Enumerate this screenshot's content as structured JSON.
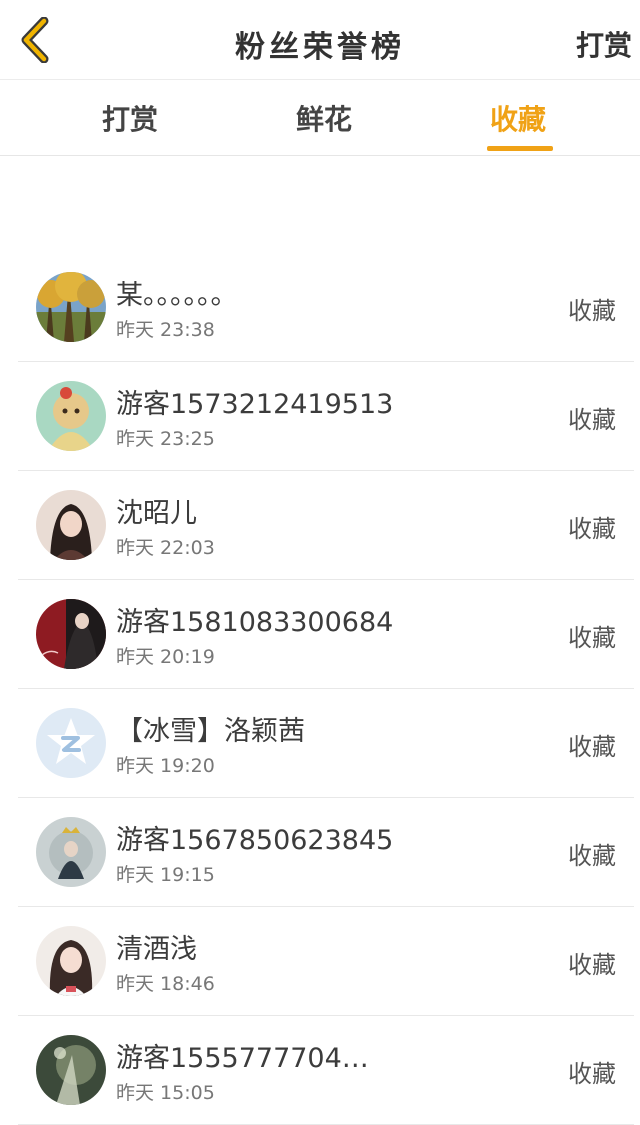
{
  "header": {
    "title": "粉丝荣誉榜",
    "action": "打赏",
    "back_icon": "chevron-left-icon",
    "back_color": "#f0b400"
  },
  "tabs": [
    {
      "label": "打赏",
      "active": false
    },
    {
      "label": "鲜花",
      "active": false
    },
    {
      "label": "收藏",
      "active": true
    }
  ],
  "accent_color": "#f0a216",
  "fans": [
    {
      "name": "某。。。。。。",
      "time": "昨天 23:38",
      "action": "收藏"
    },
    {
      "name": "游客1573212419513",
      "time": "昨天 23:25",
      "action": "收藏"
    },
    {
      "name": "沈昭儿",
      "time": "昨天 22:03",
      "action": "收藏"
    },
    {
      "name": "游客1581083300684",
      "time": "昨天 20:19",
      "action": "收藏"
    },
    {
      "name": "【冰雪】洛颖茜",
      "time": "昨天 19:20",
      "action": "收藏"
    },
    {
      "name": "游客1567850623845",
      "time": "昨天 19:15",
      "action": "收藏"
    },
    {
      "name": "清酒浅",
      "time": "昨天 18:46",
      "action": "收藏"
    },
    {
      "name": "游客1555777704…",
      "time": "昨天 15:05",
      "action": "收藏"
    }
  ]
}
